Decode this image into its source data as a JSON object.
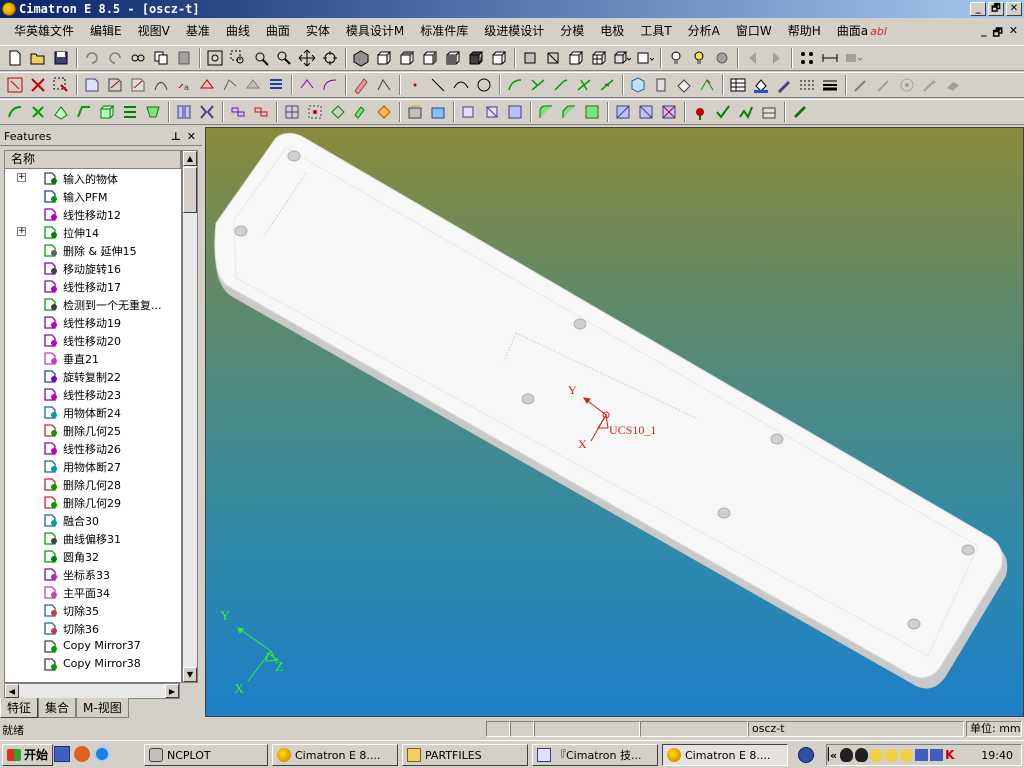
{
  "window": {
    "title": "Cimatron E 8.5 - [oscz-t]",
    "caption_buttons": [
      "_",
      "🗗",
      "✕"
    ]
  },
  "menu": {
    "items": [
      "华英雄文件",
      "编辑E",
      "视图V",
      "基准",
      "曲线",
      "曲面",
      "实体",
      "模具设计M",
      "标准件库",
      "级进模设计",
      "分模",
      "电极",
      "工具T",
      "分析A",
      "窗口W",
      "帮助H",
      "曲面a"
    ],
    "mdi_buttons": [
      "_",
      "🗗",
      "✕"
    ]
  },
  "panel": {
    "title": "Features",
    "pin": "ᵖ",
    "close": "✕",
    "column_header": "名称",
    "items": [
      {
        "label": "输入的物体",
        "expand": "+",
        "icon": "imported-body-icon"
      },
      {
        "label": "输入PFM",
        "expand": "",
        "icon": "import-pfm-icon"
      },
      {
        "label": "线性移动12",
        "expand": "",
        "icon": "linear-move-icon"
      },
      {
        "label": "拉伸14",
        "expand": "+",
        "icon": "extrude-icon"
      },
      {
        "label": "删除 & 延伸15",
        "expand": "",
        "icon": "delete-extend-icon"
      },
      {
        "label": "移动旋转16",
        "expand": "",
        "icon": "move-rotate-icon"
      },
      {
        "label": "线性移动17",
        "expand": "",
        "icon": "linear-move-icon"
      },
      {
        "label": "检测到一个无重复...",
        "expand": "",
        "icon": "detect-icon"
      },
      {
        "label": "线性移动19",
        "expand": "",
        "icon": "linear-move-icon"
      },
      {
        "label": "线性移动20",
        "expand": "",
        "icon": "linear-move-icon"
      },
      {
        "label": "垂直21",
        "expand": "",
        "icon": "perpendicular-icon"
      },
      {
        "label": "旋转复制22",
        "expand": "",
        "icon": "rotate-copy-icon"
      },
      {
        "label": "线性移动23",
        "expand": "",
        "icon": "linear-move-icon"
      },
      {
        "label": "用物体断24",
        "expand": "",
        "icon": "split-body-icon"
      },
      {
        "label": "删除几何25",
        "expand": "",
        "icon": "delete-geometry-icon"
      },
      {
        "label": "线性移动26",
        "expand": "",
        "icon": "linear-move-icon"
      },
      {
        "label": "用物体断27",
        "expand": "",
        "icon": "split-body-icon"
      },
      {
        "label": "删除几何28",
        "expand": "",
        "icon": "delete-geometry-icon"
      },
      {
        "label": "删除几何29",
        "expand": "",
        "icon": "delete-geometry-icon"
      },
      {
        "label": "融合30",
        "expand": "",
        "icon": "blend-icon"
      },
      {
        "label": "曲线偏移31",
        "expand": "",
        "icon": "curve-offset-icon"
      },
      {
        "label": "圆角32",
        "expand": "",
        "icon": "fillet-icon"
      },
      {
        "label": "坐标系33",
        "expand": "",
        "icon": "ucs-icon"
      },
      {
        "label": "主平面34",
        "expand": "",
        "icon": "main-plane-icon"
      },
      {
        "label": "切除35",
        "expand": "",
        "icon": "cut-icon"
      },
      {
        "label": "切除36",
        "expand": "",
        "icon": "cut-icon"
      },
      {
        "label": "Copy Mirror37",
        "expand": "",
        "icon": "mirror-icon"
      },
      {
        "label": "Copy Mirror38",
        "expand": "",
        "icon": "mirror-icon"
      }
    ],
    "tabs": [
      "特征",
      "集合",
      "M-视图"
    ]
  },
  "viewport": {
    "ucs_label": "UCS10_1",
    "ucs_axis_y": "Y",
    "ucs_axis_x": "X",
    "triad_y": "Y",
    "triad_x": "X",
    "triad_z": "Z"
  },
  "status": {
    "left": "就绪",
    "file": "oscz-t",
    "unit": "单位: mm"
  },
  "taskbar": {
    "start": "开始",
    "tasks": [
      "NCPLOT",
      "Cimatron E 8....",
      "PARTFILES",
      "『Cimatron 技...",
      "Cimatron E 8...."
    ],
    "tray_prefix": "«",
    "clock": "19:40"
  }
}
